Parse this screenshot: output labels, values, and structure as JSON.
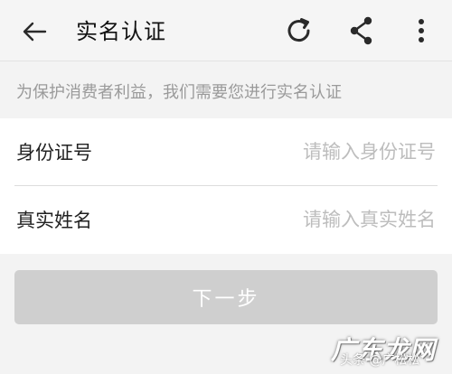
{
  "header": {
    "title": "实名认证",
    "back_icon": "arrow-left-icon",
    "refresh_icon": "refresh-icon",
    "share_icon": "share-icon",
    "more_icon": "more-vertical-icon"
  },
  "notice": {
    "text": "为保护消费者利益，我们需要您进行实名认证"
  },
  "form": {
    "id_number": {
      "label": "身份证号",
      "value": "",
      "placeholder": "请输入身份证号"
    },
    "real_name": {
      "label": "真实姓名",
      "value": "",
      "placeholder": "请输入真实姓名"
    }
  },
  "actions": {
    "next_label": "下一步"
  },
  "watermark": {
    "brand": "广东龙网",
    "caption": "头条 @广松松"
  },
  "colors": {
    "header_bg": "#f5f5f5",
    "page_bg": "#f3f3f3",
    "notice_text": "#9a9a9a",
    "placeholder": "#bdbdbd",
    "button_disabled": "#cfcfcf"
  }
}
